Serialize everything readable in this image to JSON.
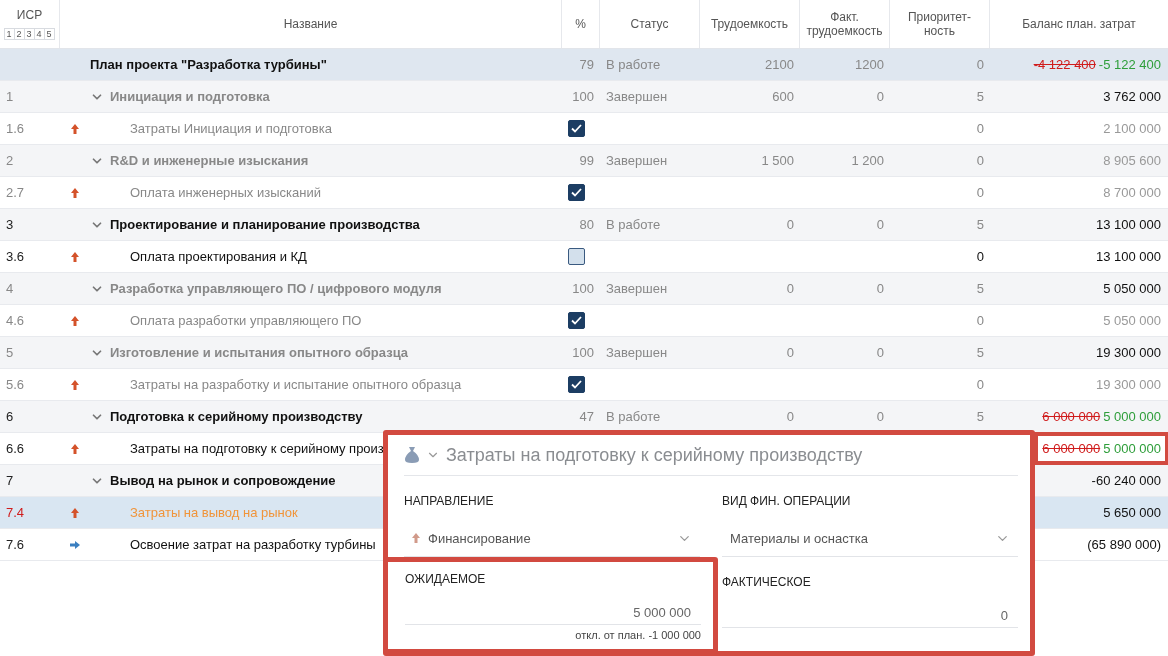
{
  "table": {
    "wbs_header": "ИСР",
    "levels": [
      "1",
      "2",
      "3",
      "4",
      "5"
    ],
    "columns": [
      "Название",
      "%",
      "Статус",
      "Трудоемкость",
      "Факт. трудоемкость",
      "Приоритет-ность",
      "Баланс план. затрат"
    ],
    "rows": [
      {
        "kind": "root",
        "selected": false,
        "done": false,
        "name": "План проекта \"Разработка турбины\"",
        "percent": "79",
        "status": "В работе",
        "effort": "2100",
        "actual_effort": "1200",
        "priority": "0",
        "balance_old": "-4 122 400",
        "balance": "-5 122 400"
      },
      {
        "kind": "group",
        "selected": false,
        "done": true,
        "balance_muted": false,
        "wbs": "1",
        "name": "Инициация и подготовка",
        "percent": "100",
        "status": "Завершен",
        "effort": "600",
        "actual_effort": "0",
        "priority": "5",
        "balance": "3 762 000"
      },
      {
        "kind": "item",
        "selected": false,
        "done": true,
        "balance_muted": true,
        "wbs": "1.6",
        "transfer": false,
        "name": "Затраты Инициация и подготовка",
        "checked": true,
        "priority": "0",
        "balance": "2 100 000"
      },
      {
        "kind": "group",
        "selected": false,
        "done": true,
        "balance_muted": true,
        "wbs": "2",
        "name": "R&D и инженерные изыскания",
        "percent": "99",
        "status": "Завершен",
        "effort": "1 500",
        "actual_effort": "1 200",
        "priority": "0",
        "balance": "8 905 600"
      },
      {
        "kind": "item",
        "selected": false,
        "done": true,
        "balance_muted": true,
        "wbs": "2.7",
        "transfer": false,
        "name": "Оплата инженерных изысканий",
        "checked": true,
        "priority": "0",
        "balance": "8 700 000"
      },
      {
        "kind": "group",
        "selected": false,
        "done": false,
        "balance_muted": false,
        "wbs": "3",
        "name": "Проектирование и планирование производства",
        "percent": "80",
        "status": "В работе",
        "effort": "0",
        "actual_effort": "0",
        "priority": "5",
        "balance": "13 100 000"
      },
      {
        "kind": "item",
        "selected": false,
        "done": false,
        "balance_muted": false,
        "wbs": "3.6",
        "transfer": false,
        "name": "Оплата проектирования и КД",
        "checked": false,
        "priority": "0",
        "balance": "13 100 000"
      },
      {
        "kind": "group",
        "selected": false,
        "done": true,
        "balance_muted": false,
        "wbs": "4",
        "name": "Разработка управляющего ПО / цифрового модуля",
        "percent": "100",
        "status": "Завершен",
        "effort": "0",
        "actual_effort": "0",
        "priority": "5",
        "balance": "5 050 000"
      },
      {
        "kind": "item",
        "selected": false,
        "done": true,
        "balance_muted": true,
        "wbs": "4.6",
        "transfer": false,
        "name": "Оплата разработки управляющего ПО",
        "checked": true,
        "priority": "0",
        "balance": "5 050 000"
      },
      {
        "kind": "group",
        "selected": false,
        "done": true,
        "balance_muted": false,
        "wbs": "5",
        "name": "Изготовление и испытания опытного образца",
        "percent": "100",
        "status": "Завершен",
        "effort": "0",
        "actual_effort": "0",
        "priority": "5",
        "balance": "19 300 000"
      },
      {
        "kind": "item",
        "selected": false,
        "done": true,
        "balance_muted": true,
        "wbs": "5.6",
        "transfer": false,
        "name": "Затраты на разработку и испытание опытного образца",
        "checked": true,
        "priority": "0",
        "balance": "19 300 000"
      },
      {
        "kind": "group",
        "selected": false,
        "done": false,
        "wbs": "6",
        "name": "Подготовка к серийному производству",
        "percent": "47",
        "status": "В работе",
        "effort": "0",
        "actual_effort": "0",
        "priority": "5",
        "balance_old": "6 000 000",
        "balance": "5 000 000"
      },
      {
        "kind": "item",
        "selected": false,
        "done": false,
        "wbs": "6.6",
        "transfer": false,
        "name": "Затраты на подготовку к серийному произ",
        "highlighted": true,
        "balance_old": "6 000 000",
        "balance": "5 000 000"
      },
      {
        "kind": "group",
        "selected": false,
        "done": false,
        "balance_muted": false,
        "wbs": "7",
        "name": "Вывод на рынок и сопровождение",
        "balance": "-60 240 000"
      },
      {
        "kind": "item",
        "selected": true,
        "done": false,
        "balance_muted": false,
        "wbs": "7.4",
        "transfer": false,
        "name": "Затраты на вывод на рынок",
        "balance": "5 650 000"
      },
      {
        "kind": "item",
        "selected": false,
        "done": false,
        "balance_muted": false,
        "wbs": "7.6",
        "transfer": true,
        "name": "Освоение затрат на разработку турбины",
        "balance": "(65 890 000)"
      }
    ]
  },
  "popup": {
    "title": "Затраты на подготовку к серийному производству",
    "direction": {
      "label": "НАПРАВЛЕНИЕ",
      "value": "Финансирование"
    },
    "operation": {
      "label": "ВИД ФИН. ОПЕРАЦИИ",
      "value": "Материалы и оснастка"
    },
    "expected": {
      "label": "ОЖИДАЕМОЕ",
      "value": "5 000 000",
      "note": "откл. от план. -1 000 000",
      "highlighted": true
    },
    "actual": {
      "label": "ФАКТИЧЕСКОЕ",
      "value": "0"
    }
  }
}
